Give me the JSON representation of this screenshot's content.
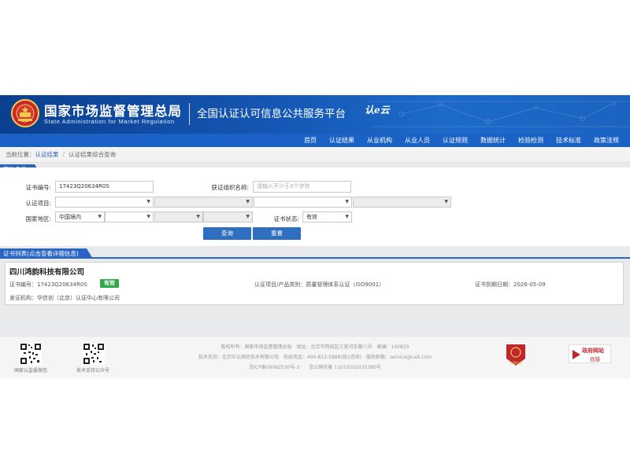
{
  "header": {
    "title_cn": "国家市场监督管理总局",
    "title_en": "State Administration for Market Regulation",
    "platform_title": "全国认证认可信息公共服务平台",
    "brand_logo": "认e云"
  },
  "nav": {
    "items": [
      "首页",
      "认证结果",
      "从业机构",
      "从业人员",
      "认证规则",
      "数据统计",
      "检验检测",
      "技术标准",
      "政策法规"
    ]
  },
  "breadcrumb": {
    "prefix": "当前位置：",
    "items": [
      "认证结果",
      "认证结果综合查询"
    ]
  },
  "query": {
    "section_title": "查询条件",
    "cert_no_label": "证书编号:",
    "cert_no_value": "17423Q20634R0S",
    "org_label": "获证组织名称:",
    "org_placeholder": "请输入不少于3个字符",
    "project_label": "认证项目:",
    "region_label": "国家地区:",
    "region_value": "中国境内",
    "status_label": "证书状态:",
    "status_value": "有效",
    "search_button": "查询",
    "reset_button": "重置"
  },
  "results": {
    "section_title": "证书列表(点击查看详细信息)",
    "items": [
      {
        "company": "四川鸿韵科技有限公司",
        "cert_no_label": "证书编号：",
        "cert_no": "17423Q20634R0S",
        "status": "有效",
        "category_label": "认证项目/产品类别：",
        "category": "质量管理体系认证（ISO9001）",
        "expiry_label": "证书到期日期：",
        "expiry": "2026-05-09",
        "issuer_label": "发证机构：",
        "issuer": "华信创（北京）认证中心有限公司"
      }
    ]
  },
  "footer": {
    "qr1_caption": "国家认监委微信",
    "qr2_caption": "技术支持公众号",
    "line1": "版权所有：国家市场监督管理总局　地址：北京市西城区三里河东路八号　邮编：100820",
    "line2": "技术支持：北京中认网信技术有限公司　热线电话：400-813-5888(按2咨询)　服务邮箱：service@cait.com",
    "line3": "京ICP备09062530号-3　　京公网安备 11010502035380号",
    "badge_caption": "党政机关",
    "gov_site_t1": "政府网站",
    "gov_site_t2": "找错"
  },
  "colors": {
    "banner": "#1558b5",
    "nav": "#1a62c6",
    "accent": "#2a64c4",
    "status_green": "#2fa84a"
  }
}
